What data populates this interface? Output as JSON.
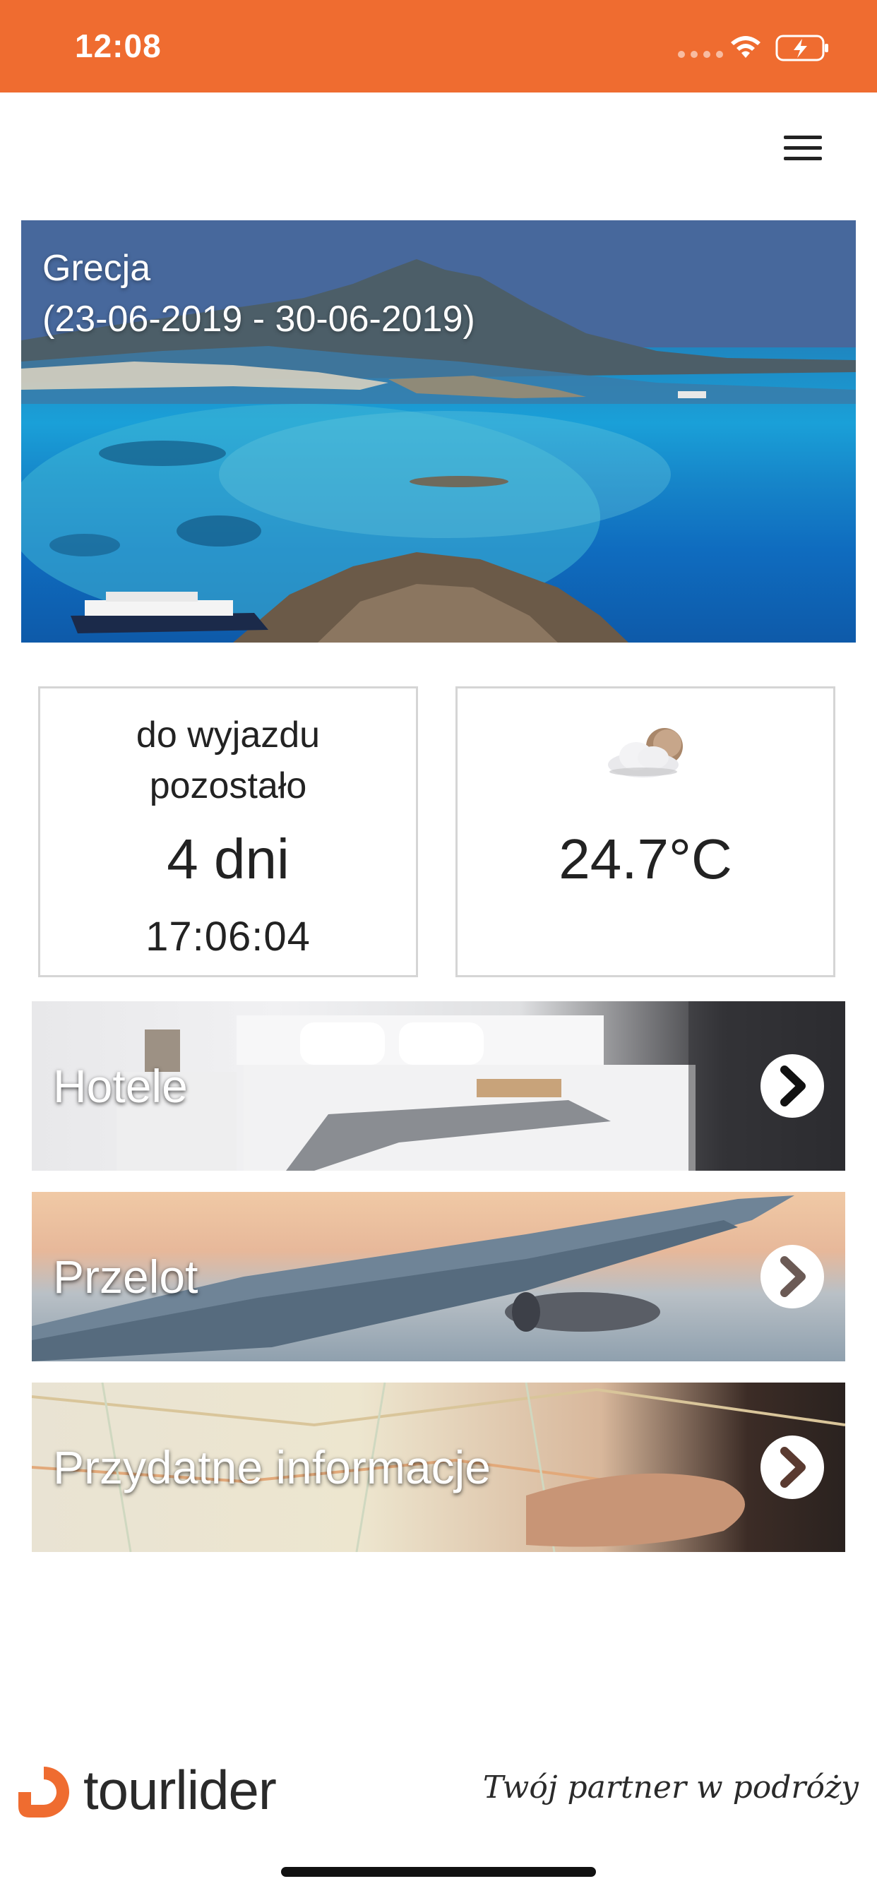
{
  "status_bar": {
    "time": "12:08",
    "background": "#ef6c30"
  },
  "header": {
    "menu_icon": "hamburger-menu-icon"
  },
  "hero": {
    "destination": "Grecja",
    "dates": "(23-06-2019 - 30-06-2019)"
  },
  "countdown": {
    "label_line1": "do wyjazdu",
    "label_line2": "pozostało",
    "days": "4 dni",
    "time": "17:06:04"
  },
  "weather": {
    "icon": "partly-cloudy-icon",
    "temperature": "24.7°C"
  },
  "menu": {
    "items": [
      {
        "label": "Hotele",
        "icon": "chevron-right-icon"
      },
      {
        "label": "Przelot",
        "icon": "chevron-right-icon"
      },
      {
        "label": "Przydatne informacje",
        "icon": "chevron-right-icon"
      }
    ]
  },
  "footer": {
    "brand": "tourlider",
    "tagline": "Twój partner w podróży",
    "brand_color": "#ef6c30"
  }
}
